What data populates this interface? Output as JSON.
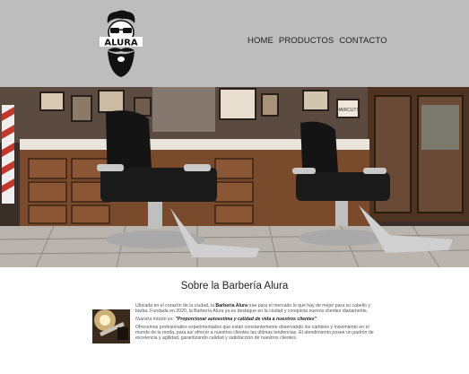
{
  "logo": {
    "brand": "ALURA",
    "icon": "barber-mustache-logo"
  },
  "nav": {
    "items": [
      "HOME",
      "PRODUCTOS",
      "CONTACTO"
    ]
  },
  "hero": {
    "image": "barbershop-interior-photo",
    "shop_sign": "HAIRCUTS"
  },
  "about": {
    "title": "Sobre la Barbería Alura",
    "p1_a": "Ubicada en el corazón de la ciudad, la ",
    "p1_b": "Barbería Alura",
    "p1_c": " trae para el mercado lo que hay de mejor para su cabello y barba. Fundada en 2020, la Barbería Alura ya es destaque en la ciudad y conquista nuevos clientes diariamente.",
    "p2_a": "Nuestra misión es: ",
    "p2_b": "\"Proporcionar autoestima y calidad de vida a nuestros clientes\"",
    "p2_c": ".",
    "p3": "Ofrecemos profesionales experimentados que están constantemente observando los cambios y movimiento en el mundo de la moda, para así ofrecer a nuestros clientes las últimas tendencias. El atendimiento posee un padrón de excelencia y agilidad, garantizando calidad y satisfacción de nuestros clientes.",
    "thumb": "barber-razor-photo"
  }
}
